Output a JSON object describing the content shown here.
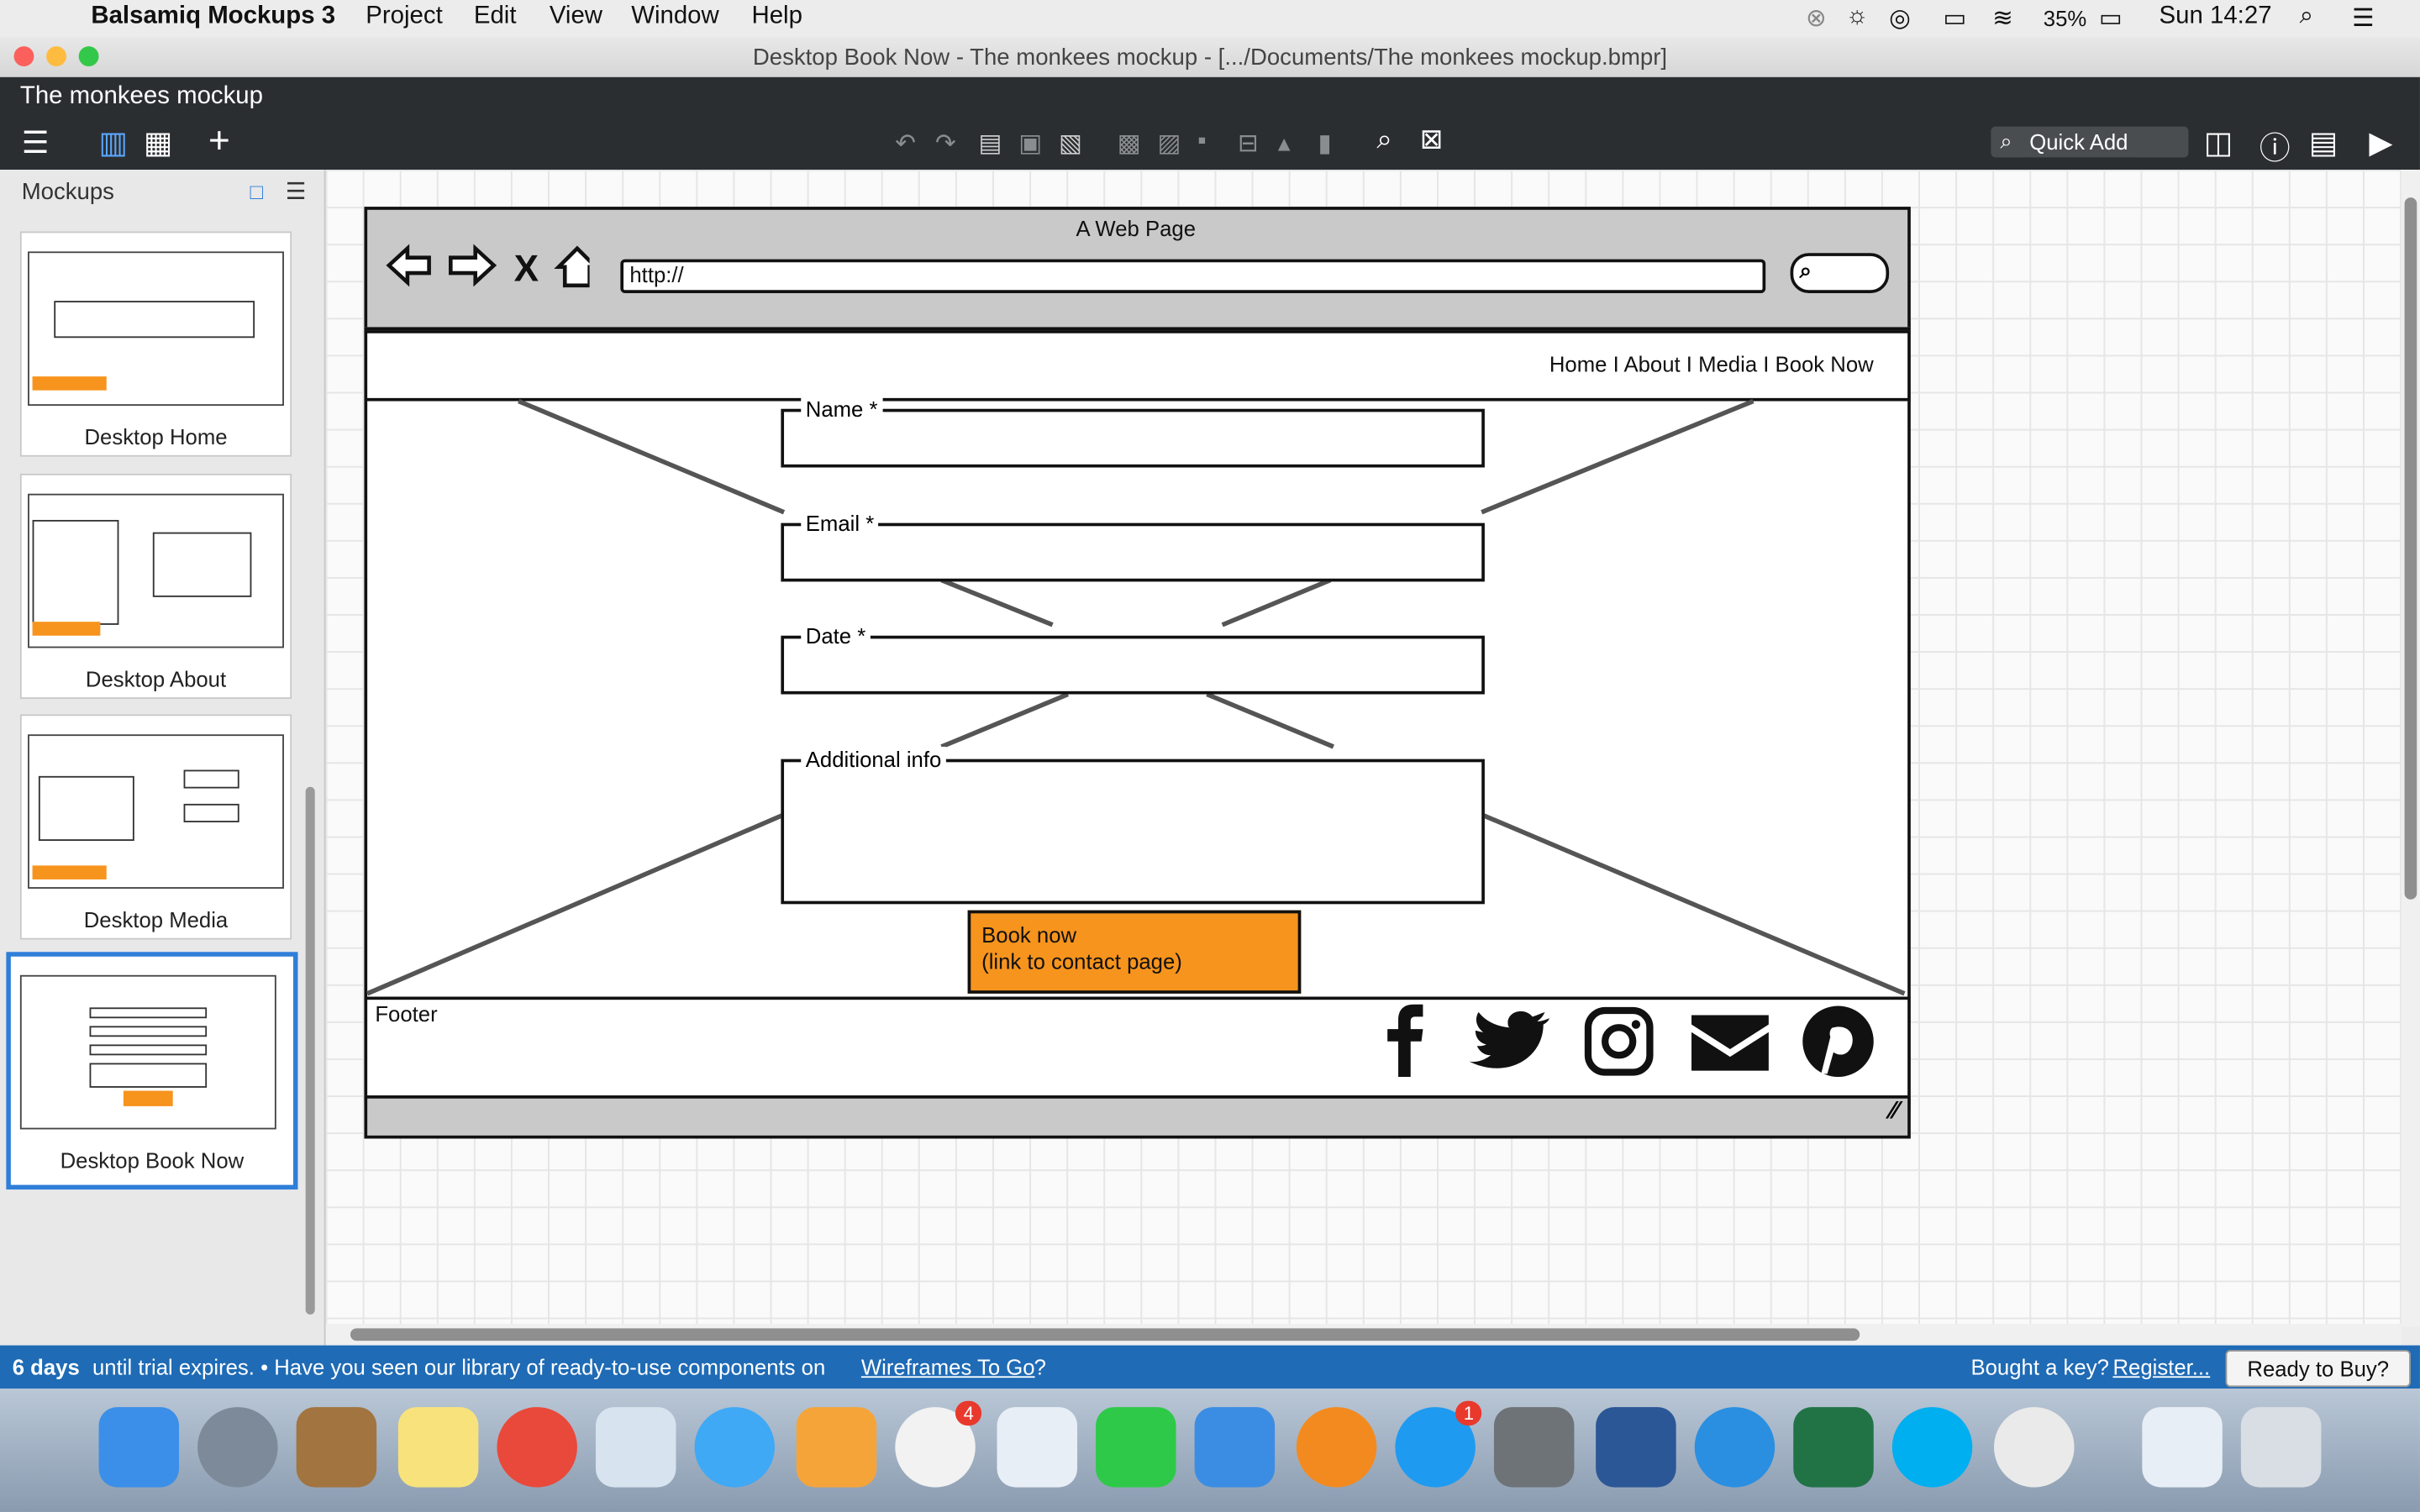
{
  "menubar": {
    "app_name": "Balsamiq Mockups 3",
    "items": [
      "Project",
      "Edit",
      "View",
      "Window",
      "Help"
    ],
    "battery": "35%",
    "clock": "Sun 14:27"
  },
  "window": {
    "title": "Desktop Book Now - The monkees mockup - [.../Documents/The monkees mockup.bmpr]"
  },
  "app": {
    "project_title": "The monkees mockup",
    "quick_add_label": "Quick Add"
  },
  "sidebar": {
    "title": "Mockups",
    "items": [
      {
        "label": "Desktop Home"
      },
      {
        "label": "Desktop About"
      },
      {
        "label": "Desktop Media"
      },
      {
        "label": "Desktop Book Now"
      }
    ]
  },
  "mockup": {
    "page_title": "A Web Page",
    "url": "http://",
    "nav_links": "Home I About I Media I Book Now",
    "fields": {
      "name_label": "Name *",
      "email_label": "Email *",
      "date_label": "Date *",
      "info_label": "Additional info"
    },
    "button_line1": "Book now",
    "button_line2": "(link to contact page)",
    "footer_label": "Footer",
    "social_icons": [
      "facebook-icon",
      "twitter-icon",
      "instagram-icon",
      "mail-icon",
      "pinterest-icon"
    ],
    "accent_color": "#f7941d"
  },
  "trial": {
    "days": "6 days",
    "message": " until trial expires. • Have you seen our library of ready-to-use components on ",
    "link": "Wireframes To Go",
    "question": "?",
    "bought": "Bought a key? ",
    "register": "Register...",
    "buy_button": "Ready to Buy?"
  },
  "dock": {
    "badges": {
      "photos": "4",
      "appstore": "1"
    }
  }
}
